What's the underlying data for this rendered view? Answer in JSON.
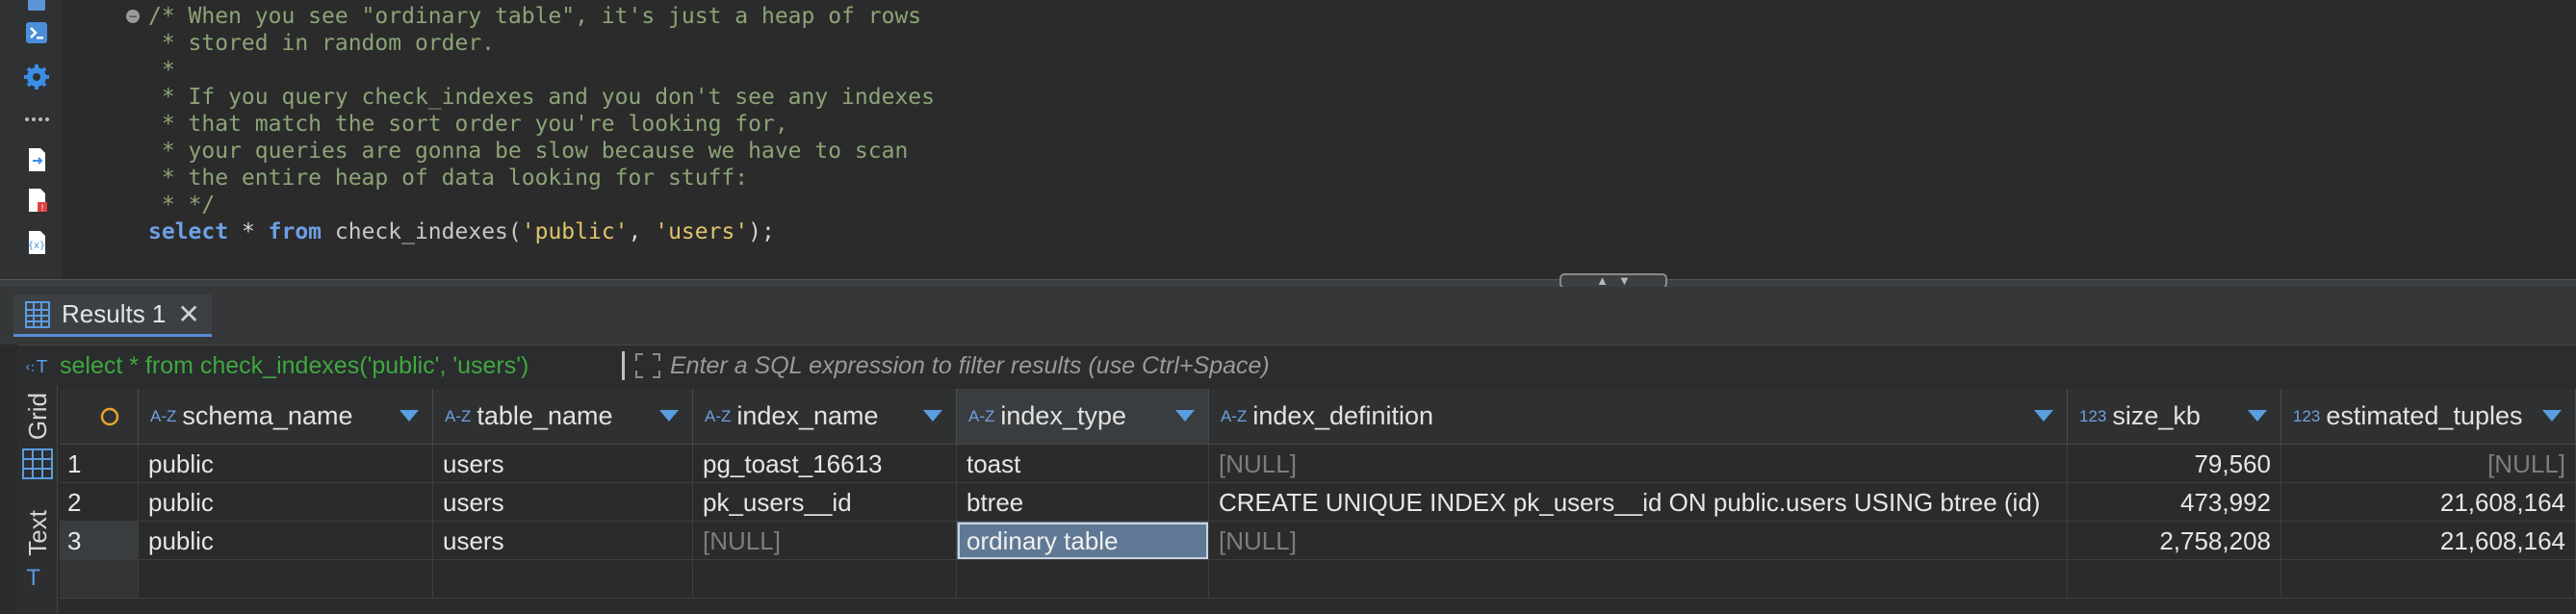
{
  "editor": {
    "comment_lines": [
      "/* When you see \"ordinary table\", it's just a heap of rows",
      " * stored in random order.",
      " *",
      " * If you query check_indexes and you don't see any indexes",
      " * that match the sort order you're looking for,",
      " * your queries are gonna be slow because we have to scan",
      " * the entire heap of data looking for stuff:",
      " * */"
    ],
    "sql": {
      "kw_select": "select",
      "star": " * ",
      "kw_from": "from",
      "fn_open": " check_indexes(",
      "arg1": "'public'",
      "comma": ", ",
      "arg2": "'users'",
      "close": ");"
    }
  },
  "results": {
    "tab_label": "Results 1",
    "close_glyph": "✕",
    "filter_query": "select * from check_indexes('public', 'users')",
    "filter_placeholder": "Enter a SQL expression to filter results (use Ctrl+Space)",
    "view_tabs": [
      "Grid",
      "Text"
    ]
  },
  "grid": {
    "columns": [
      {
        "type": "A-Z",
        "name": "schema_name"
      },
      {
        "type": "A-Z",
        "name": "table_name"
      },
      {
        "type": "A-Z",
        "name": "index_name"
      },
      {
        "type": "A-Z",
        "name": "index_type"
      },
      {
        "type": "A-Z",
        "name": "index_definition"
      },
      {
        "type": "123",
        "name": "size_kb"
      },
      {
        "type": "123",
        "name": "estimated_tuples"
      }
    ],
    "rows": [
      {
        "num": "1",
        "schema_name": "public",
        "table_name": "users",
        "index_name": "pg_toast_16613",
        "index_type": "toast",
        "index_definition": "[NULL]",
        "size_kb": "79,560",
        "estimated_tuples": "[NULL]"
      },
      {
        "num": "2",
        "schema_name": "public",
        "table_name": "users",
        "index_name": "pk_users__id",
        "index_type": "btree",
        "index_definition": "CREATE UNIQUE INDEX pk_users__id ON public.users USING btree (id)",
        "size_kb": "473,992",
        "estimated_tuples": "21,608,164"
      },
      {
        "num": "3",
        "schema_name": "public",
        "table_name": "users",
        "index_name": "[NULL]",
        "index_type": "ordinary table",
        "index_definition": "[NULL]",
        "size_kb": "2,758,208",
        "estimated_tuples": "21,608,164"
      }
    ]
  },
  "colors": {
    "comment": "#8ca477",
    "keyword": "#6e9fe6",
    "string": "#e0c46c",
    "filter_query": "#3fa83f",
    "selection": "#5f7893"
  }
}
